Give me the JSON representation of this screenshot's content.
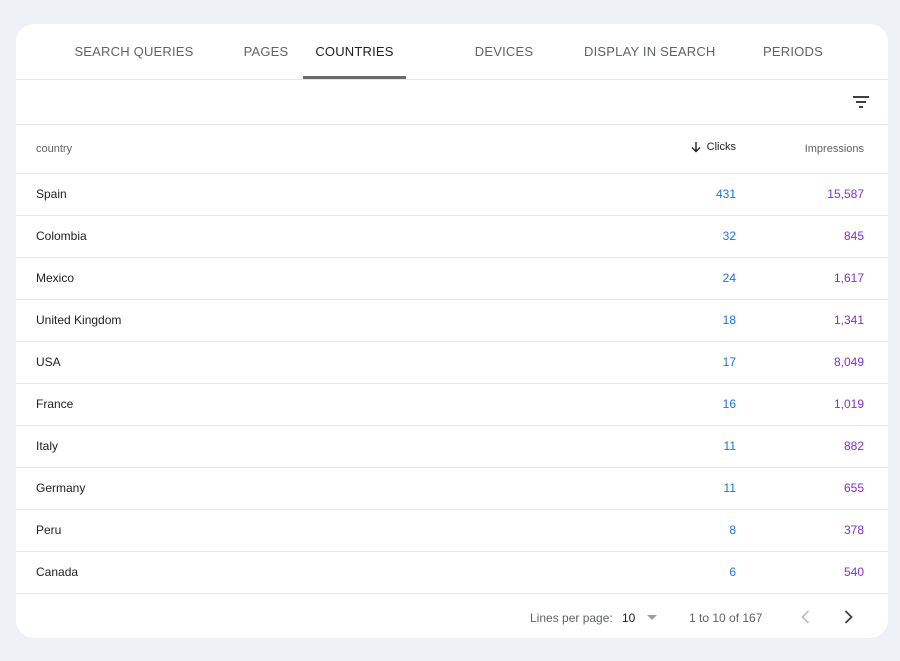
{
  "tabs": [
    {
      "label": "SEARCH QUERIES",
      "active": false
    },
    {
      "label": "PAGES",
      "active": false
    },
    {
      "label": "COUNTRIES",
      "active": true
    },
    {
      "label": "DEVICES",
      "active": false
    },
    {
      "label": "DISPLAY IN SEARCH",
      "active": false
    },
    {
      "label": "PERIODS",
      "active": false
    }
  ],
  "toolbar": {
    "filter_icon": "filter-icon"
  },
  "table": {
    "headers": {
      "country": "country",
      "clicks": "Clicks",
      "impressions": "Impressions"
    },
    "sort": {
      "column": "clicks",
      "direction": "descending",
      "icon": "arrow-down-icon"
    },
    "rows": [
      {
        "country": "Spain",
        "clicks": "431",
        "impressions": "15,587"
      },
      {
        "country": "Colombia",
        "clicks": "32",
        "impressions": "845"
      },
      {
        "country": "Mexico",
        "clicks": "24",
        "impressions": "1,617"
      },
      {
        "country": "United Kingdom",
        "clicks": "18",
        "impressions": "1,341"
      },
      {
        "country": "USA",
        "clicks": "17",
        "impressions": "8,049"
      },
      {
        "country": "France",
        "clicks": "16",
        "impressions": "1,019"
      },
      {
        "country": "Italy",
        "clicks": "11",
        "impressions": "882"
      },
      {
        "country": "Germany",
        "clicks": "11",
        "impressions": "655"
      },
      {
        "country": "Peru",
        "clicks": "8",
        "impressions": "378"
      },
      {
        "country": "Canada",
        "clicks": "6",
        "impressions": "540"
      }
    ]
  },
  "pagination": {
    "lines_per_page_label": "Lines per page:",
    "lines_per_page_value": "10",
    "range_text": "1 to 10 of 167"
  },
  "colors": {
    "clicks": "#1a73e8",
    "impressions": "#8430ce",
    "background": "#eef1f6",
    "active_tab_indicator": "#6b6b6b"
  }
}
